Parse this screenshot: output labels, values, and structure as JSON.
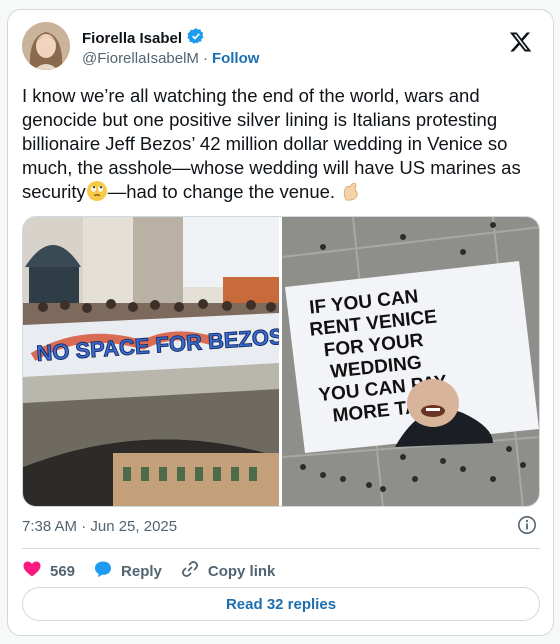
{
  "author": {
    "name": "Fiorella Isabel",
    "handle": "@FiorellaIsabelM",
    "separator": "·",
    "follow_label": "Follow",
    "verified": true
  },
  "tweet": {
    "text_part1": "I know we’re all watching the end of the world, wars and genocide but one positive silver lining is Italians protesting billionaire Jeff Bezos’ 42 million dollar wedding in Venice so much, the asshole—whose wedding will have US marines as security",
    "emoji1": "face-with-rolling-eyes",
    "text_part2": "—had to change the venue. ",
    "emoji2": "pinching-hand"
  },
  "media": {
    "left_image_banner_text": "NO SPACE FOR BEZOS",
    "right_image_banner_lines": [
      "IF YOU CAN",
      "RENT VENICE",
      "FOR YOUR",
      "WEDDING",
      "YOU CAN PAY",
      "MORE TAX"
    ]
  },
  "meta": {
    "timestamp": "7:38 AM · Jun 25, 2025"
  },
  "actions": {
    "like_count": "569",
    "reply_label": "Reply",
    "copy_link_label": "Copy link",
    "read_replies_label": "Read 32 replies"
  },
  "colors": {
    "like": "#f91880",
    "link": "#1d6fb0",
    "verified": "#1d9bf0"
  }
}
